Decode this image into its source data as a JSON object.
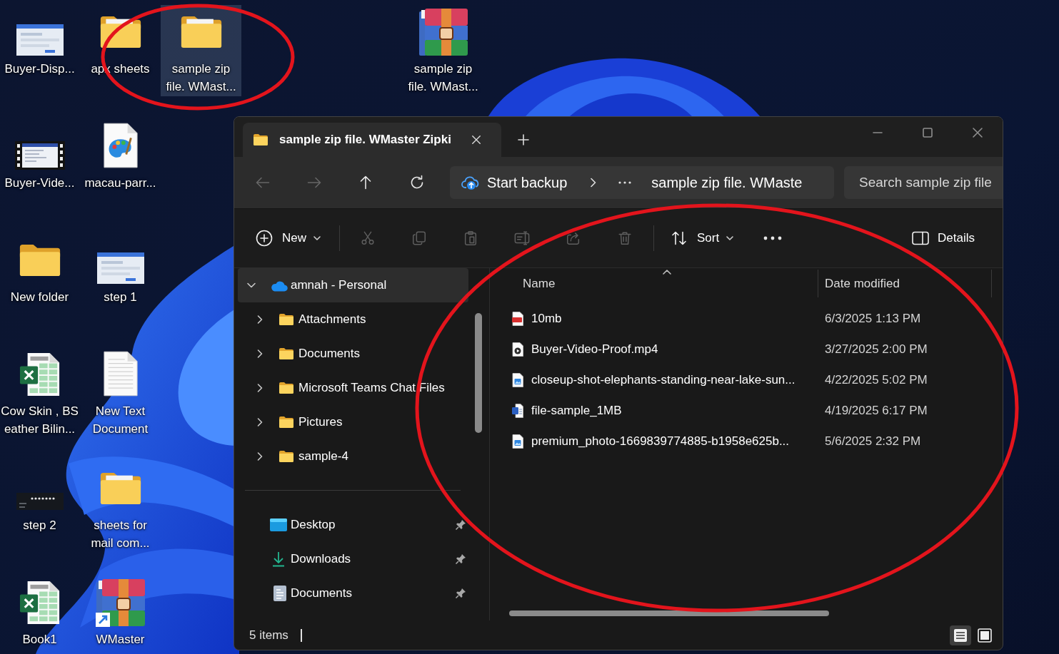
{
  "desktop_icons": [
    {
      "label": "Buyer-Disp...",
      "kind": "thumbnail",
      "selected": false
    },
    {
      "label": "Buyer-Vide...",
      "kind": "video",
      "selected": false
    },
    {
      "label": "New folder",
      "kind": "emptyfolder",
      "selected": false
    },
    {
      "label": "Cow Skin , BS\neather Bilin...",
      "kind": "sheet",
      "selected": false
    },
    {
      "label": "step 2",
      "kind": "screenshot",
      "selected": false
    },
    {
      "label": "Book1",
      "kind": "sheet",
      "selected": false
    },
    {
      "label": "apx sheets",
      "kind": "folder",
      "selected": false
    },
    {
      "label": "macau-parr...",
      "kind": "picture",
      "selected": false
    },
    {
      "label": "step 1",
      "kind": "thumbnail",
      "selected": false
    },
    {
      "label": "New Text\nDocument",
      "kind": "text",
      "selected": false
    },
    {
      "label": "sheets for\nmail com...",
      "kind": "folder",
      "selected": false
    },
    {
      "label": "WMaster",
      "kind": "shortcut",
      "selected": false
    },
    {
      "label": "sample zip\nfile. WMast...",
      "kind": "folder",
      "selected": true
    }
  ],
  "desktop_icon_far": {
    "label": "sample zip\nfile. WMast...",
    "kind": "archive",
    "selected": false
  },
  "explorer": {
    "tabs": [
      {
        "title": "sample zip file. WMaster Zipki",
        "selected": true
      }
    ],
    "nav_buttons": [
      {
        "kind": "back",
        "disabled": true
      },
      {
        "kind": "forward",
        "disabled": true
      },
      {
        "kind": "up",
        "disabled": false
      },
      {
        "kind": "refresh",
        "disabled": false
      }
    ],
    "address": {
      "backup": "Start backup",
      "path": "sample zip file. WMaste"
    },
    "search": {
      "placeholder": "Search sample zip file"
    },
    "toolbar": {
      "new": "New",
      "actions": [
        {
          "kind": "cut",
          "disabled": true
        },
        {
          "kind": "copy",
          "disabled": true
        },
        {
          "kind": "paste",
          "disabled": true
        },
        {
          "kind": "rename",
          "disabled": true
        },
        {
          "kind": "share",
          "disabled": true
        },
        {
          "kind": "delete",
          "disabled": true
        }
      ],
      "sort": "Sort",
      "details": "Details"
    },
    "nav_pane": {
      "tree": [
        {
          "label": "amnah - Personal",
          "kind": "cloud",
          "expanded": true,
          "selected": true,
          "children": [
            {
              "label": "Attachments",
              "kind": "folder",
              "expanded": false,
              "selected": false
            },
            {
              "label": "Documents",
              "kind": "folder",
              "expanded": false,
              "selected": false
            },
            {
              "label": "Microsoft Teams Chat Files",
              "kind": "folder",
              "expanded": false,
              "selected": false
            },
            {
              "label": "Pictures",
              "kind": "folder",
              "expanded": false,
              "selected": false
            },
            {
              "label": "sample-4",
              "kind": "folder",
              "expanded": false,
              "selected": false
            }
          ]
        }
      ],
      "quick_access": [
        {
          "label": "Desktop",
          "kind": "desktop",
          "pinned": true,
          "selected": false
        },
        {
          "label": "Downloads",
          "kind": "downloads",
          "pinned": true,
          "selected": false
        },
        {
          "label": "Documents",
          "kind": "documents",
          "pinned": true,
          "selected": false
        }
      ]
    },
    "file_list": {
      "columns": [
        {
          "label": "Name",
          "sorted": true
        },
        {
          "label": "Date modified",
          "sorted": false
        }
      ],
      "rows": [
        {
          "name": "10mb",
          "kind": "pdf",
          "modified": "6/3/2025 1:13 PM"
        },
        {
          "name": "Buyer-Video-Proof.mp4",
          "kind": "video",
          "modified": "3/27/2025 2:00 PM"
        },
        {
          "name": "closeup-shot-elephants-standing-near-lake-sun...",
          "kind": "image",
          "modified": "4/22/2025 5:02 PM"
        },
        {
          "name": "file-sample_1MB",
          "kind": "word",
          "modified": "4/19/2025 6:17 PM"
        },
        {
          "name": "premium_photo-1669839774885-b1958e625b...",
          "kind": "image",
          "modified": "5/6/2025 2:32 PM"
        }
      ]
    },
    "status_bar": {
      "count": "5 items",
      "views": [
        {
          "kind": "details",
          "selected": true
        },
        {
          "kind": "tiles",
          "selected": false
        }
      ]
    }
  }
}
